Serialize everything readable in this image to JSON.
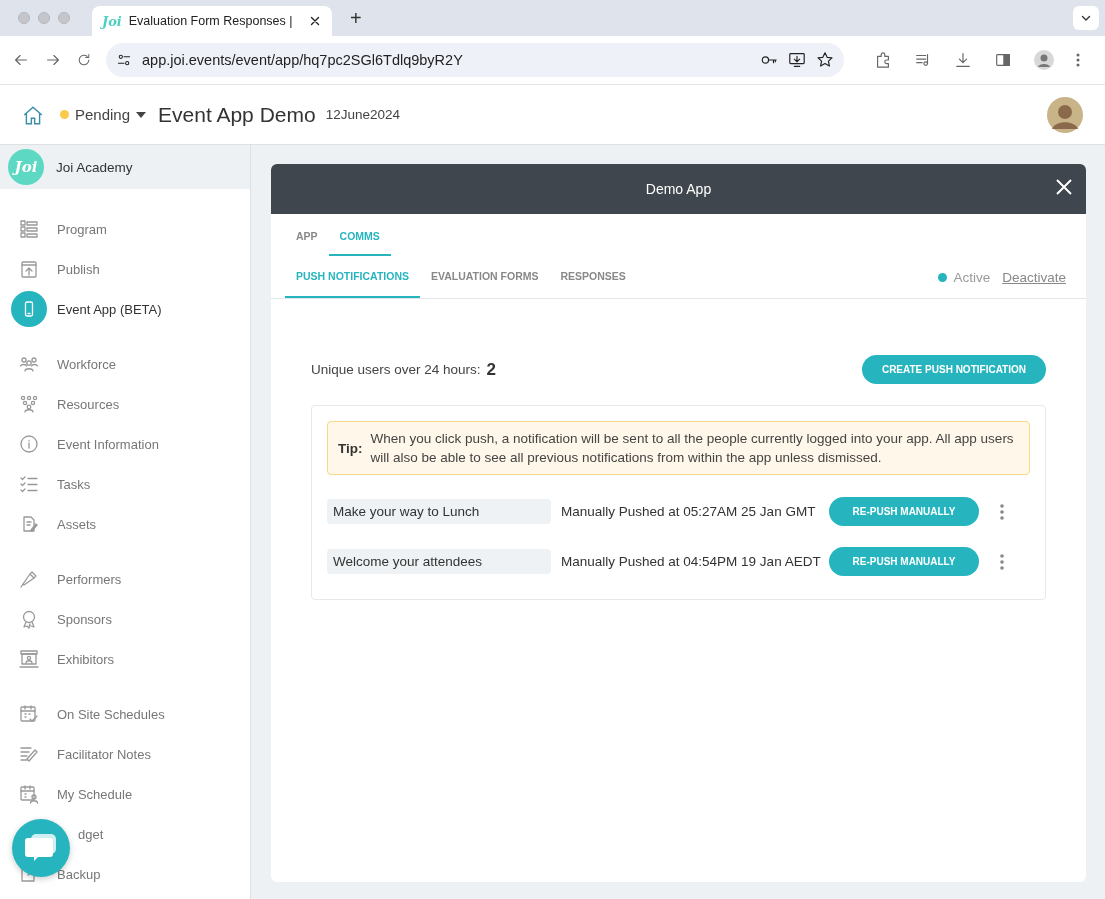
{
  "browser": {
    "tab": {
      "favicon": "Joi",
      "title": "Evaluation Form Responses |"
    },
    "new_tab": "+",
    "url": "app.joi.events/event/app/hq7pc2SGl6Tdlq9byR2Y"
  },
  "header": {
    "status": "Pending",
    "title": "Event App Demo",
    "date": "12June2024"
  },
  "sidebar": {
    "org": {
      "logo": "Joi",
      "name": "Joi Academy"
    },
    "groups": [
      [
        {
          "label": "Program",
          "selected": false
        },
        {
          "label": "Publish",
          "selected": false
        },
        {
          "label": "Event App (BETA)",
          "selected": true
        }
      ],
      [
        {
          "label": "Workforce",
          "selected": false
        },
        {
          "label": "Resources",
          "selected": false
        },
        {
          "label": "Event Information",
          "selected": false
        },
        {
          "label": "Tasks",
          "selected": false
        },
        {
          "label": "Assets",
          "selected": false
        }
      ],
      [
        {
          "label": "Performers",
          "selected": false
        },
        {
          "label": "Sponsors",
          "selected": false
        },
        {
          "label": "Exhibitors",
          "selected": false
        }
      ],
      [
        {
          "label": "On Site Schedules",
          "selected": false
        },
        {
          "label": "Facilitator Notes",
          "selected": false
        },
        {
          "label": "My Schedule",
          "selected": false
        },
        {
          "label": "dget",
          "selected": false
        },
        {
          "label": "Backup",
          "selected": false
        }
      ]
    ]
  },
  "modal": {
    "title": "Demo App",
    "tabs": [
      {
        "label": "APP",
        "selected": false
      },
      {
        "label": "COMMS",
        "selected": true
      }
    ],
    "subtabs": [
      {
        "label": "PUSH NOTIFICATIONS",
        "selected": true
      },
      {
        "label": "EVALUATION FORMS",
        "selected": false
      },
      {
        "label": "RESPONSES",
        "selected": false
      }
    ],
    "status": {
      "label": "Active",
      "action": "Deactivate"
    },
    "unique_users": {
      "label": "Unique users over 24 hours:",
      "value": "2"
    },
    "create_button": "CREATE PUSH NOTIFICATION",
    "tip": {
      "label": "Tip:",
      "text": "When you click push, a notification will be sent to all the people currently logged into your app. All app users will also be able to see all previous notifications from within the app unless dismissed."
    },
    "notifications": [
      {
        "title": "Make your way to Lunch",
        "pushed": "Manually Pushed at 05:27AM 25 Jan GMT",
        "button": "RE-PUSH MANUALLY"
      },
      {
        "title": "Welcome your attendees",
        "pushed": "Manually Pushed at 04:54PM 19 Jan AEDT",
        "button": "RE-PUSH MANUALLY"
      }
    ]
  }
}
